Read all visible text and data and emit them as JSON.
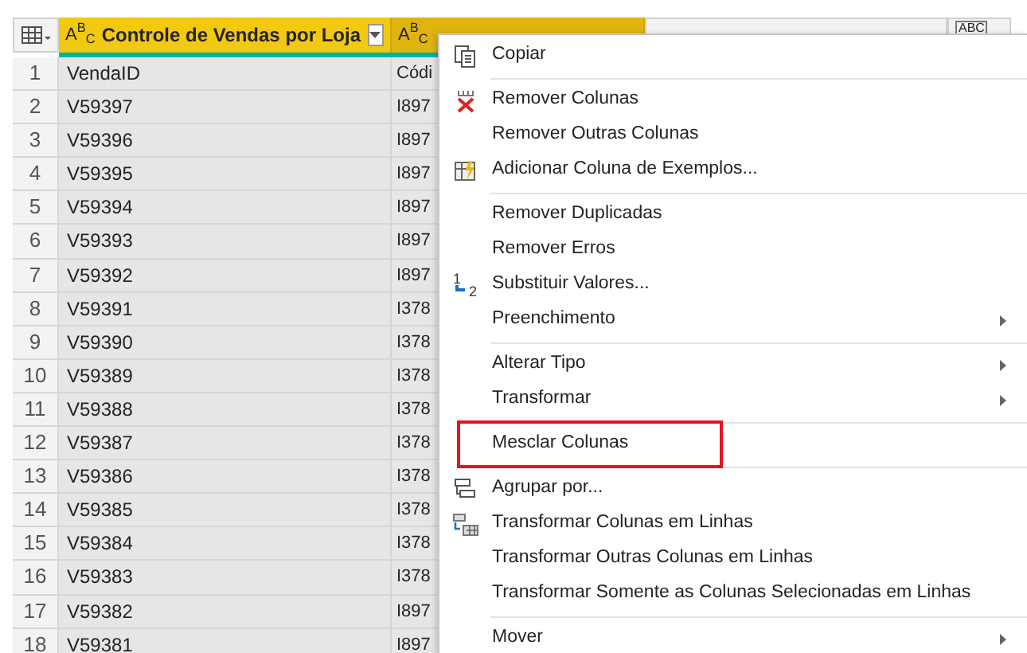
{
  "table": {
    "columns": [
      {
        "type_label": "A$^{B}$$_{C}$",
        "title": "Controle de Vendas por Loja",
        "selected": true
      },
      {
        "type_label": "A$^{B}$$_{C}$",
        "selected": true
      },
      {
        "selected": false
      },
      {
        "type_label": "ABC",
        "selected": false
      }
    ],
    "rows": [
      {
        "number": "1",
        "cells": [
          "VendaID",
          "Códi"
        ]
      },
      {
        "number": "2",
        "cells": [
          "V59397",
          "I897"
        ]
      },
      {
        "number": "3",
        "cells": [
          "V59396",
          "I897"
        ]
      },
      {
        "number": "4",
        "cells": [
          "V59395",
          "I897"
        ]
      },
      {
        "number": "5",
        "cells": [
          "V59394",
          "I897"
        ]
      },
      {
        "number": "6",
        "cells": [
          "V59393",
          "I897"
        ]
      },
      {
        "number": "7",
        "cells": [
          "V59392",
          "I897"
        ]
      },
      {
        "number": "8",
        "cells": [
          "V59391",
          "I378"
        ]
      },
      {
        "number": "9",
        "cells": [
          "V59390",
          "I378"
        ]
      },
      {
        "number": "10",
        "cells": [
          "V59389",
          "I378"
        ]
      },
      {
        "number": "11",
        "cells": [
          "V59388",
          "I378"
        ]
      },
      {
        "number": "12",
        "cells": [
          "V59387",
          "I378"
        ]
      },
      {
        "number": "13",
        "cells": [
          "V59386",
          "I378"
        ]
      },
      {
        "number": "14",
        "cells": [
          "V59385",
          "I378"
        ]
      },
      {
        "number": "15",
        "cells": [
          "V59384",
          "I378"
        ]
      },
      {
        "number": "16",
        "cells": [
          "V59383",
          "I378"
        ]
      },
      {
        "number": "17",
        "cells": [
          "V59382",
          "I897"
        ]
      },
      {
        "number": "18",
        "cells": [
          "V59381",
          "I897"
        ]
      }
    ]
  },
  "context_menu": {
    "items": [
      {
        "kind": "command",
        "label": "Copiar",
        "submenu": false,
        "highlighted": false
      },
      {
        "kind": "separator"
      },
      {
        "kind": "command",
        "label": "Remover Colunas",
        "submenu": false,
        "highlighted": false
      },
      {
        "kind": "command",
        "label": "Remover Outras Colunas",
        "submenu": false,
        "highlighted": false
      },
      {
        "kind": "command",
        "label": "Adicionar Coluna de Exemplos...",
        "submenu": false,
        "highlighted": false
      },
      {
        "kind": "separator"
      },
      {
        "kind": "command",
        "label": "Remover Duplicadas",
        "submenu": false,
        "highlighted": false
      },
      {
        "kind": "command",
        "label": "Remover Erros",
        "submenu": false,
        "highlighted": false
      },
      {
        "kind": "command",
        "label": "Substituir Valores...",
        "icon_texts": [
          "1",
          "2"
        ],
        "submenu": false,
        "highlighted": false
      },
      {
        "kind": "command",
        "label": "Preenchimento",
        "submenu": true,
        "highlighted": false
      },
      {
        "kind": "separator"
      },
      {
        "kind": "command",
        "label": "Alterar Tipo",
        "submenu": true,
        "highlighted": false
      },
      {
        "kind": "command",
        "label": "Transformar",
        "submenu": true,
        "highlighted": false
      },
      {
        "kind": "separator"
      },
      {
        "kind": "command",
        "label": "Mesclar Colunas",
        "submenu": false,
        "highlighted": true
      },
      {
        "kind": "separator"
      },
      {
        "kind": "command",
        "label": "Agrupar por...",
        "submenu": false,
        "highlighted": false
      },
      {
        "kind": "command",
        "label": "Transformar Colunas em Linhas",
        "submenu": false,
        "highlighted": false
      },
      {
        "kind": "command",
        "label": "Transformar Outras Colunas em Linhas",
        "submenu": false,
        "highlighted": false
      },
      {
        "kind": "command",
        "label": "Transformar Somente as Colunas Selecionadas em Linhas",
        "submenu": false,
        "highlighted": false
      },
      {
        "kind": "separator"
      },
      {
        "kind": "command",
        "label": "Mover",
        "submenu": true,
        "highlighted": false
      }
    ]
  }
}
